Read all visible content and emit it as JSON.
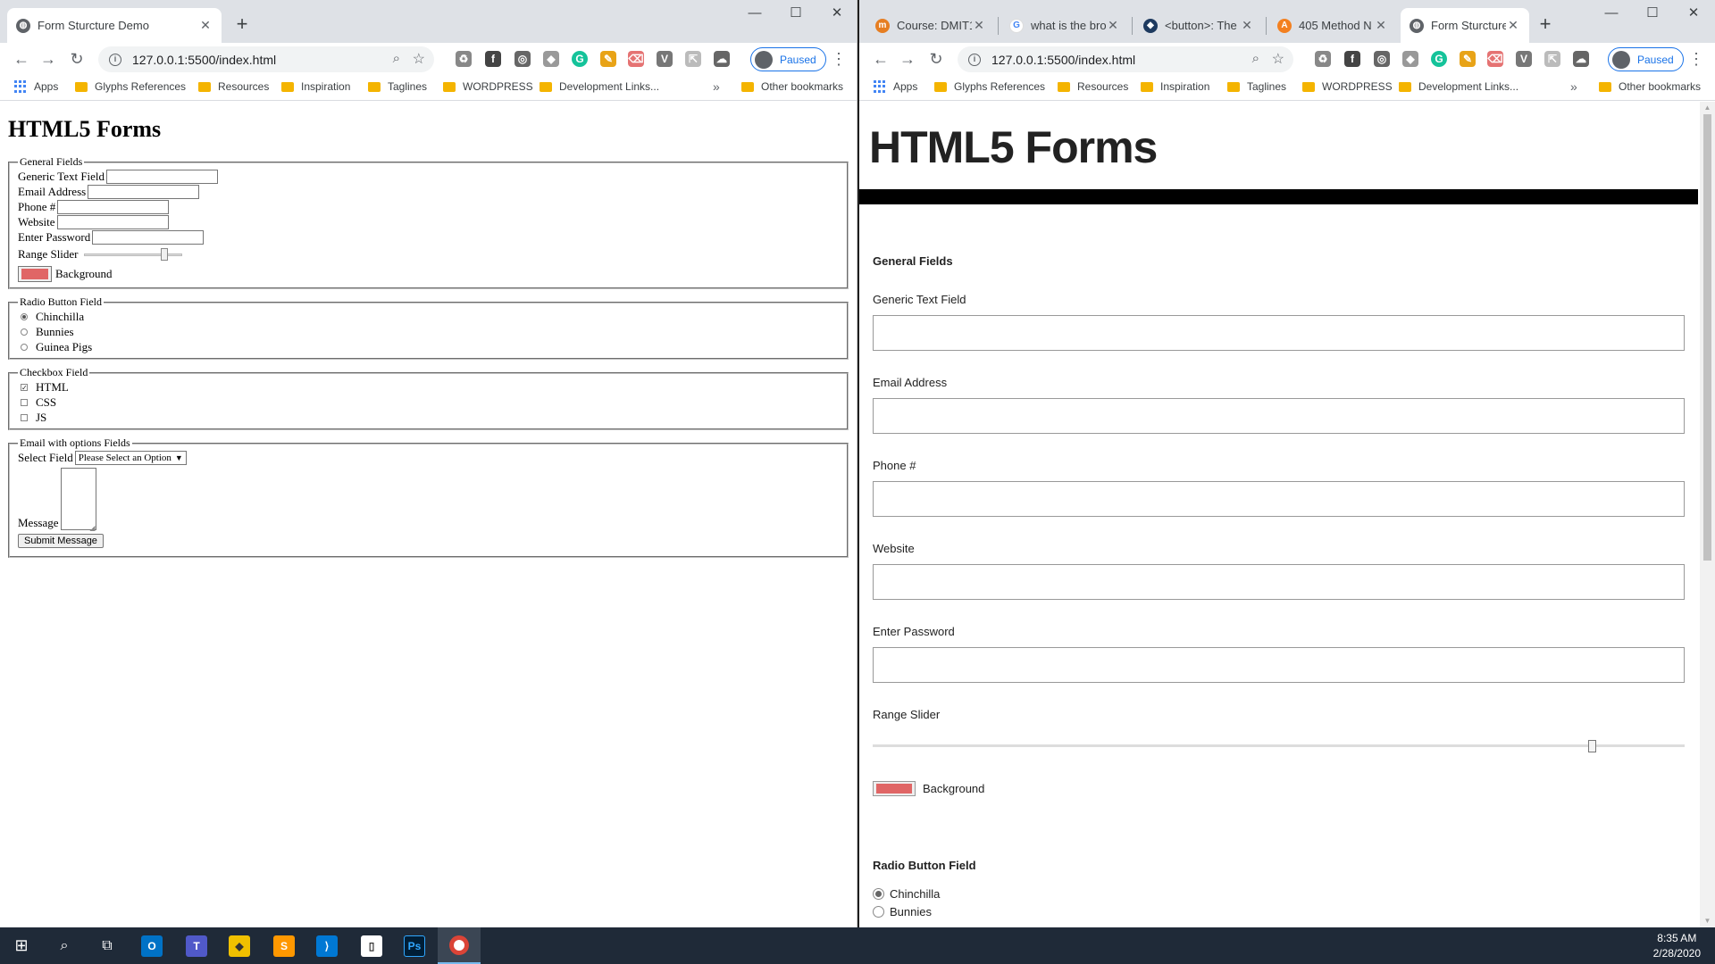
{
  "left_window": {
    "tab_title": "Form Sturcture Demo",
    "url": "127.0.0.1:5500/index.html",
    "profile_status": "Paused",
    "bookmarks": [
      "Apps",
      "Glyphs References",
      "Resources",
      "Inspiration",
      "Taglines",
      "WORDPRESS",
      "Development Links...",
      "Other bookmarks"
    ],
    "page": {
      "heading": "HTML5 Forms",
      "general": {
        "legend": "General Fields",
        "generic_text": "Generic Text Field",
        "email": "Email Address",
        "phone": "Phone #",
        "website": "Website",
        "password": "Enter Password",
        "range": "Range Slider",
        "range_value": 0.85,
        "background": "Background"
      },
      "radio": {
        "legend": "Radio Button Field",
        "options": [
          "Chinchilla",
          "Bunnies",
          "Guinea Pigs"
        ]
      },
      "checkbox": {
        "legend": "Checkbox Field",
        "options": [
          "HTML",
          "CSS",
          "JS"
        ]
      },
      "email_options": {
        "legend": "Email with options Fields",
        "select_label": "Select Field",
        "select_value": "Please Select an Option",
        "message_label": "Message",
        "submit": "Submit Message"
      }
    }
  },
  "right_window": {
    "tabs": [
      "Course: DMIT1",
      "what is the bro",
      "<button>: The",
      "405 Method N",
      "Form Sturcture"
    ],
    "url": "127.0.0.1:5500/index.html",
    "profile_status": "Paused",
    "bookmarks": [
      "Apps",
      "Glyphs References",
      "Resources",
      "Inspiration",
      "Taglines",
      "WORDPRESS",
      "Development Links...",
      "Other bookmarks"
    ],
    "page": {
      "heading": "HTML5 Forms",
      "section_title": "General Fields",
      "generic_text": "Generic Text Field",
      "email": "Email Address",
      "phone": "Phone #",
      "website": "Website",
      "password": "Enter Password",
      "range": "Range Slider",
      "range_value": 0.89,
      "background": "Background",
      "radio_title": "Radio Button Field",
      "radio_options": [
        "Chinchilla",
        "Bunnies"
      ]
    }
  },
  "taskbar": {
    "time": "8:35 AM",
    "date": "2/28/2020"
  },
  "colors": {
    "swatch": "#e06666",
    "accent": "#1a73e8",
    "taskbar": "#1f2a38"
  }
}
